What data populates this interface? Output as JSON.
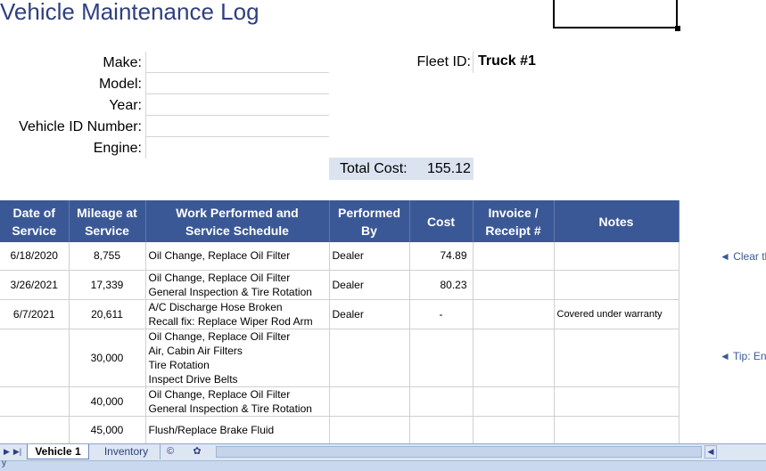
{
  "header": {
    "title": "Vehicle Maintenance Log"
  },
  "vehicle_info": {
    "labels": [
      "Make:",
      "Model:",
      "Year:",
      "Vehicle ID Number:",
      "Engine:"
    ],
    "values": [
      "",
      "",
      "",
      "",
      ""
    ],
    "fleet_label": "Fleet ID:",
    "fleet_value": "Truck #1"
  },
  "summary": {
    "total_label": "Total Cost:",
    "total_value": "155.12"
  },
  "table": {
    "columns": [
      [
        "Date of",
        "Service"
      ],
      [
        "Mileage at",
        "Service"
      ],
      [
        "Work Performed and",
        "Service Schedule"
      ],
      [
        "Performed",
        "By"
      ],
      [
        "Cost"
      ],
      [
        "Invoice /",
        "Receipt #"
      ],
      [
        "Notes"
      ]
    ],
    "rows": [
      {
        "date": "6/18/2020",
        "mileage": "8,755",
        "work": [
          "Oil Change, Replace Oil Filter"
        ],
        "by": "Dealer",
        "cost": "74.89",
        "invoice": "",
        "notes": ""
      },
      {
        "date": "3/26/2021",
        "mileage": "17,339",
        "work": [
          "Oil Change, Replace Oil Filter",
          "General Inspection & Tire Rotation"
        ],
        "by": "Dealer",
        "cost": "80.23",
        "invoice": "",
        "notes": ""
      },
      {
        "date": "6/7/2021",
        "mileage": "20,611",
        "work": [
          "A/C Discharge Hose Broken",
          "Recall fix: Replace Wiper Rod Arm"
        ],
        "by": "Dealer",
        "cost": "-",
        "invoice": "",
        "notes": "Covered under warranty"
      },
      {
        "date": "",
        "mileage": "30,000",
        "work": [
          "Oil Change, Replace Oil Filter",
          "Air, Cabin Air Filters",
          "Tire Rotation",
          "Inspect Drive Belts"
        ],
        "by": "",
        "cost": "",
        "invoice": "",
        "notes": ""
      },
      {
        "date": "",
        "mileage": "40,000",
        "work": [
          "Oil Change, Replace Oil Filter",
          "General Inspection & Tire Rotation"
        ],
        "by": "",
        "cost": "",
        "invoice": "",
        "notes": ""
      },
      {
        "date": "",
        "mileage": "45,000",
        "work": [
          "Flush/Replace Brake Fluid"
        ],
        "by": "",
        "cost": "",
        "invoice": "",
        "notes": ""
      }
    ]
  },
  "side_notes": {
    "clear": "◄ Clear th",
    "tip": "◄ Tip: En"
  },
  "sheet_tabs": {
    "active": "Vehicle 1",
    "inactive": "Inventory",
    "extra_1": "©",
    "extra_2": "✿"
  },
  "colors": {
    "title": "#2f3f7f",
    "header_bg": "#3b5896",
    "total_bg": "#dbe3f1"
  }
}
